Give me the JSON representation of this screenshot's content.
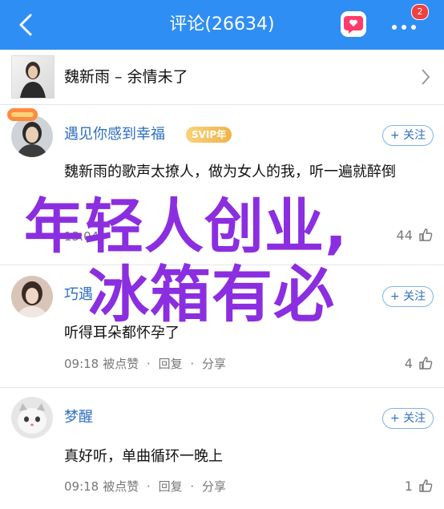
{
  "header": {
    "title": "评论(26634)",
    "badge_count": "2"
  },
  "song": {
    "title": "魏新雨 – 余情未了"
  },
  "comments": [
    {
      "username": "遇见你感到幸福",
      "vip": "SVIP年",
      "follow": "+ 关注",
      "text": "魏新雨的歌声太撩人，做为女人的我，听一遍就醉倒",
      "time": "13:04",
      "likes": "44"
    },
    {
      "username": "巧遇",
      "follow": "+ 关注",
      "text": "听得耳朵都怀孕了",
      "time": "09:18",
      "like_text": "被点赞",
      "reply": "回复",
      "share": "分享",
      "likes": "4"
    },
    {
      "username": "梦醒",
      "follow": "+ 关注",
      "text": "真好听，单曲循环一晚上",
      "time": "09:18",
      "like_text": "被点赞",
      "reply": "回复",
      "share": "分享",
      "likes": "1"
    }
  ],
  "overlay": {
    "line1": "年轻人创业,",
    "line2": "冰箱有必"
  },
  "colors": {
    "topbar": "#2f8ef3",
    "username": "#2f6fbf",
    "overlay": "#8b2ee0",
    "svip": "#f0b44a"
  }
}
